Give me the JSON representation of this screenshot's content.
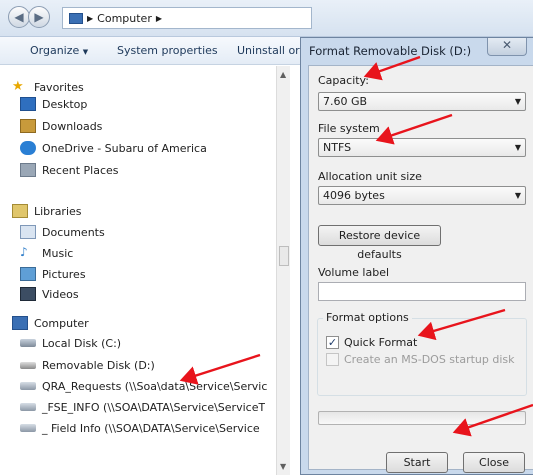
{
  "explorer": {
    "breadcrumb": "Computer",
    "toolbar": {
      "organize": "Organize",
      "system_properties": "System properties",
      "uninstall": "Uninstall or c"
    },
    "tree": [
      {
        "label": "Favorites",
        "icon": "star-icon",
        "level": 0
      },
      {
        "label": "Desktop",
        "icon": "desktop-icon",
        "level": 1
      },
      {
        "label": "Downloads",
        "icon": "downloads-icon",
        "level": 1
      },
      {
        "label": "OneDrive - Subaru of America",
        "icon": "cloud-icon",
        "level": 1
      },
      {
        "label": "Recent Places",
        "icon": "recent-places-icon",
        "level": 1
      },
      {
        "label": "Libraries",
        "icon": "libraries-icon",
        "level": 0
      },
      {
        "label": "Documents",
        "icon": "documents-icon",
        "level": 1
      },
      {
        "label": "Music",
        "icon": "music-icon",
        "level": 1
      },
      {
        "label": "Pictures",
        "icon": "pictures-icon",
        "level": 1
      },
      {
        "label": "Videos",
        "icon": "videos-icon",
        "level": 1
      },
      {
        "label": "Computer",
        "icon": "computer-icon",
        "level": 0
      },
      {
        "label": "Local Disk (C:)",
        "icon": "local-disk-icon",
        "level": 1
      },
      {
        "label": "Removable Disk (D:)",
        "icon": "removable-disk-icon",
        "level": 1
      },
      {
        "label": "QRA_Requests (\\\\Soa\\data\\Service\\Servic",
        "icon": "network-drive-icon",
        "level": 1
      },
      {
        "label": "_FSE_INFO (\\\\SOA\\DATA\\Service\\ServiceT",
        "icon": "network-drive-icon",
        "level": 1
      },
      {
        "label": "_ Field Info (\\\\SOA\\DATA\\Service\\Service",
        "icon": "network-drive-icon",
        "level": 1
      }
    ]
  },
  "dialog": {
    "title": "Format Removable Disk (D:)",
    "close_glyph": "✕",
    "capacity": {
      "label": "Capacity:",
      "value": "7.60 GB"
    },
    "file_system": {
      "label": "File system",
      "value": "NTFS"
    },
    "allocation": {
      "label": "Allocation unit size",
      "value": "4096 bytes"
    },
    "restore_button": "Restore device defaults",
    "volume_label": {
      "label": "Volume label",
      "value": ""
    },
    "format_options": {
      "label": "Format options",
      "quick_format": {
        "label": "Quick Format",
        "checked": true
      },
      "msdos_disk": {
        "label": "Create an MS-DOS startup disk",
        "checked": false,
        "enabled": false
      }
    },
    "progress": 0,
    "start_button": "Start",
    "close_button": "Close"
  },
  "colors": {
    "annotation_arrow": "#e8141c",
    "dialog_frame": "#c9d9ec",
    "progress_fill": "#06b025"
  }
}
